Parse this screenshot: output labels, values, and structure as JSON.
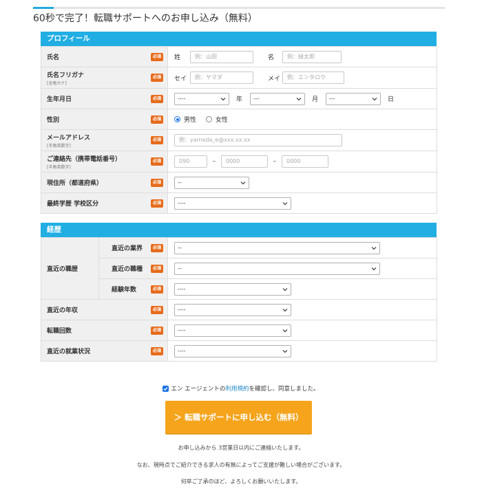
{
  "page_title": "60秒で完了！転職サポートへのお申し込み（無料）",
  "required_label": "必須",
  "colors": {
    "accent": "#20aee3",
    "required": "#e66b1b",
    "submit": "#f5a41c"
  },
  "profile": {
    "header": "プロフィール",
    "name": {
      "label": "氏名",
      "last_label": "姓",
      "last_placeholder": "例：山田",
      "first_label": "名",
      "first_placeholder": "例：緑太郎"
    },
    "kana": {
      "label": "氏名フリガナ",
      "sub": "[全角カナ]",
      "last_label": "セイ",
      "last_placeholder": "例：ヤマダ",
      "first_label": "メイ",
      "first_placeholder": "例：エンタロウ"
    },
    "birth": {
      "label": "生年月日",
      "year_value": "----",
      "year_unit": "年",
      "month_value": "---",
      "month_unit": "月",
      "day_value": "---",
      "day_unit": "日"
    },
    "gender": {
      "label": "性別",
      "male": "男性",
      "female": "女性",
      "selected": "male"
    },
    "email": {
      "label": "メールアドレス",
      "sub": "[半角英数字]",
      "placeholder": "例：yamada_e@xxx.xx.xx"
    },
    "phone": {
      "label": "ご連絡先（携帯電話番号）",
      "sub": "[半角英数字]",
      "p1": "090",
      "p2": "0000",
      "p3": "0000",
      "sep": "–"
    },
    "residence": {
      "label": "現住所（都道府県）",
      "value": "--"
    },
    "education": {
      "label": "最終学歴 学校区分",
      "value": "----"
    }
  },
  "career": {
    "header": "経歴",
    "recent_job": {
      "label": "直近の職歴",
      "industry_label": "直近の業界",
      "industry_value": "--",
      "occupation_label": "直近の職種",
      "occupation_value": "--",
      "years_label": "経験年数",
      "years_value": "----"
    },
    "income": {
      "label": "直近の年収",
      "value": "----"
    },
    "job_changes": {
      "label": "転職回数",
      "value": "----"
    },
    "employment_status": {
      "label": "直近の就業状況",
      "value": "----"
    }
  },
  "agreement": {
    "before": "エン エージェントの",
    "link": "利用規約",
    "after": "を確認し、同意しました。",
    "checked": true
  },
  "submit_label": "＞ 転職サポートに申し込む（無料）",
  "notes": [
    "お申し込みから 3営業日以内にご連絡いたします。",
    "なお、現時点でご紹介できる求人の有無によってご支援が難しい場合がございます。",
    "何卒ご了承のほど、よろしくお願いいたします。"
  ]
}
